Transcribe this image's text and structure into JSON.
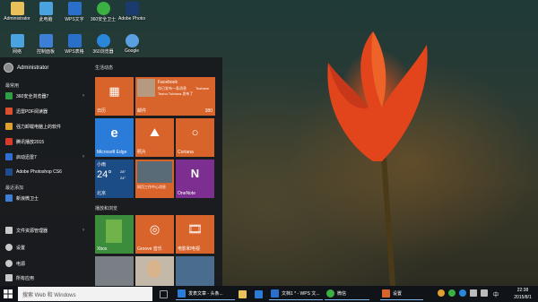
{
  "desktop": {
    "icons": [
      {
        "label": "Administrator",
        "icon": "folder-icon",
        "color": "#e8c15a"
      },
      {
        "label": "此电脑",
        "icon": "computer-icon",
        "color": "#4aa3df"
      },
      {
        "label": "WPS文字",
        "icon": "wps-writer-icon",
        "color": "#2a6fc9"
      },
      {
        "label": "360安全卫士",
        "icon": "360-security-icon",
        "color": "#3cb043"
      },
      {
        "label": "Adobe Photoshop",
        "icon": "photoshop-icon",
        "color": "#1b3b6f"
      },
      {
        "label": "网络",
        "icon": "network-icon",
        "color": "#4aa3df"
      },
      {
        "label": "控制面板",
        "icon": "control-panel-icon",
        "color": "#3d7fd4"
      },
      {
        "label": "WPS表格",
        "icon": "wps-sheet-icon",
        "color": "#2a6fc9"
      },
      {
        "label": "360浏览器",
        "icon": "360-browser-icon",
        "color": "#2a86d8"
      },
      {
        "label": "Google",
        "icon": "chrome-icon",
        "color": "#5aa0e0"
      }
    ]
  },
  "start_menu": {
    "user_name": "Administrator",
    "most_used_label": "最常用",
    "most_used": [
      {
        "label": "360安全浏览器7",
        "icon": "360-browser-icon",
        "color": "#2f9e44",
        "arrow": "›"
      },
      {
        "label": "迅雷PDF阅读器",
        "icon": "pdf-reader-icon",
        "color": "#d9502b",
        "arrow": ""
      },
      {
        "label": "强力卸载电脑上的软件",
        "icon": "uninstall-icon",
        "color": "#e0a030",
        "arrow": ""
      },
      {
        "label": "腾讯播放2015",
        "icon": "player-icon",
        "color": "#d93a2b",
        "arrow": ""
      },
      {
        "label": "启动迅雷7",
        "icon": "thunder-icon",
        "color": "#2f6fd1",
        "arrow": "›"
      },
      {
        "label": "Adobe Photoshop CS6",
        "icon": "photoshop-icon",
        "color": "#1f4c8f",
        "arrow": ""
      }
    ],
    "recent_label": "最近添加",
    "recent": [
      {
        "label": "新浪微卫士",
        "icon": "guard-icon",
        "color": "#3d7fd4"
      }
    ],
    "bottom": [
      {
        "label": "文件资源管理器",
        "icon": "file-explorer-icon",
        "arrow": "›"
      },
      {
        "label": "设置",
        "icon": "settings-icon",
        "arrow": ""
      },
      {
        "label": "电源",
        "icon": "power-icon",
        "arrow": ""
      },
      {
        "label": "所有应用",
        "icon": "all-apps-icon",
        "arrow": ""
      }
    ],
    "group1_label": "生活动态",
    "group2_label": "播放和浏览",
    "tiles": {
      "calendar": {
        "label": "日历",
        "color": "#d9642b",
        "glyph": "▦"
      },
      "facebook": {
        "title": "Facebook",
        "msg1": "你已发布一条消息",
        "msg2": "Tasha Tubtana 发布了",
        "name": "Toshane",
        "footer_label": "邮件",
        "count": "380",
        "color": "#d9642b"
      },
      "edge": {
        "label": "Microsoft Edge",
        "color": "#2b7cd8",
        "glyph": "e"
      },
      "photos": {
        "label": "照片",
        "color": "#d9642b",
        "glyph": "⛰"
      },
      "cortana": {
        "label": "Cortana",
        "color": "#d9642b",
        "glyph": "○"
      },
      "weather": {
        "title": "小雨",
        "temp": "24°",
        "hi": "28°",
        "lo": "24°",
        "city": "北京",
        "color": "#1c4c86"
      },
      "news": {
        "label": "网页工作中心消息",
        "color": "#d9642b"
      },
      "onenote": {
        "label": "OneNote",
        "color": "#7c2f90",
        "glyph": "N"
      },
      "minecraft": {
        "label": "Xbox",
        "color": "#3b8d3b"
      },
      "groove": {
        "label": "Groove 音乐",
        "color": "#d9642b",
        "glyph": "◎"
      },
      "movies": {
        "label": "电影和电视",
        "color": "#d9642b",
        "glyph": "🎞"
      }
    }
  },
  "taskbar": {
    "search_placeholder": "搜索 Web 和 Windows",
    "apps": [
      {
        "label": "",
        "icon": "task-view-icon",
        "color": "#9aa3ad"
      },
      {
        "label": "发表文章 - 头条...",
        "icon": "edge-icon",
        "color": "#2b7cd8"
      },
      {
        "label": "",
        "icon": "file-explorer-icon",
        "color": "#e8c15a"
      },
      {
        "label": "",
        "icon": "store-icon",
        "color": "#2b7cd8"
      },
      {
        "label": "文档1 * - WPS 文...",
        "icon": "wps-writer-icon",
        "color": "#2a6fc9"
      },
      {
        "label": "微信",
        "icon": "wechat-icon",
        "color": "#3cb043"
      },
      {
        "label": "设置",
        "icon": "settings-icon",
        "color": "#d9642b"
      }
    ],
    "ime": "中",
    "time": "22:38",
    "date": "2015/8/1"
  }
}
